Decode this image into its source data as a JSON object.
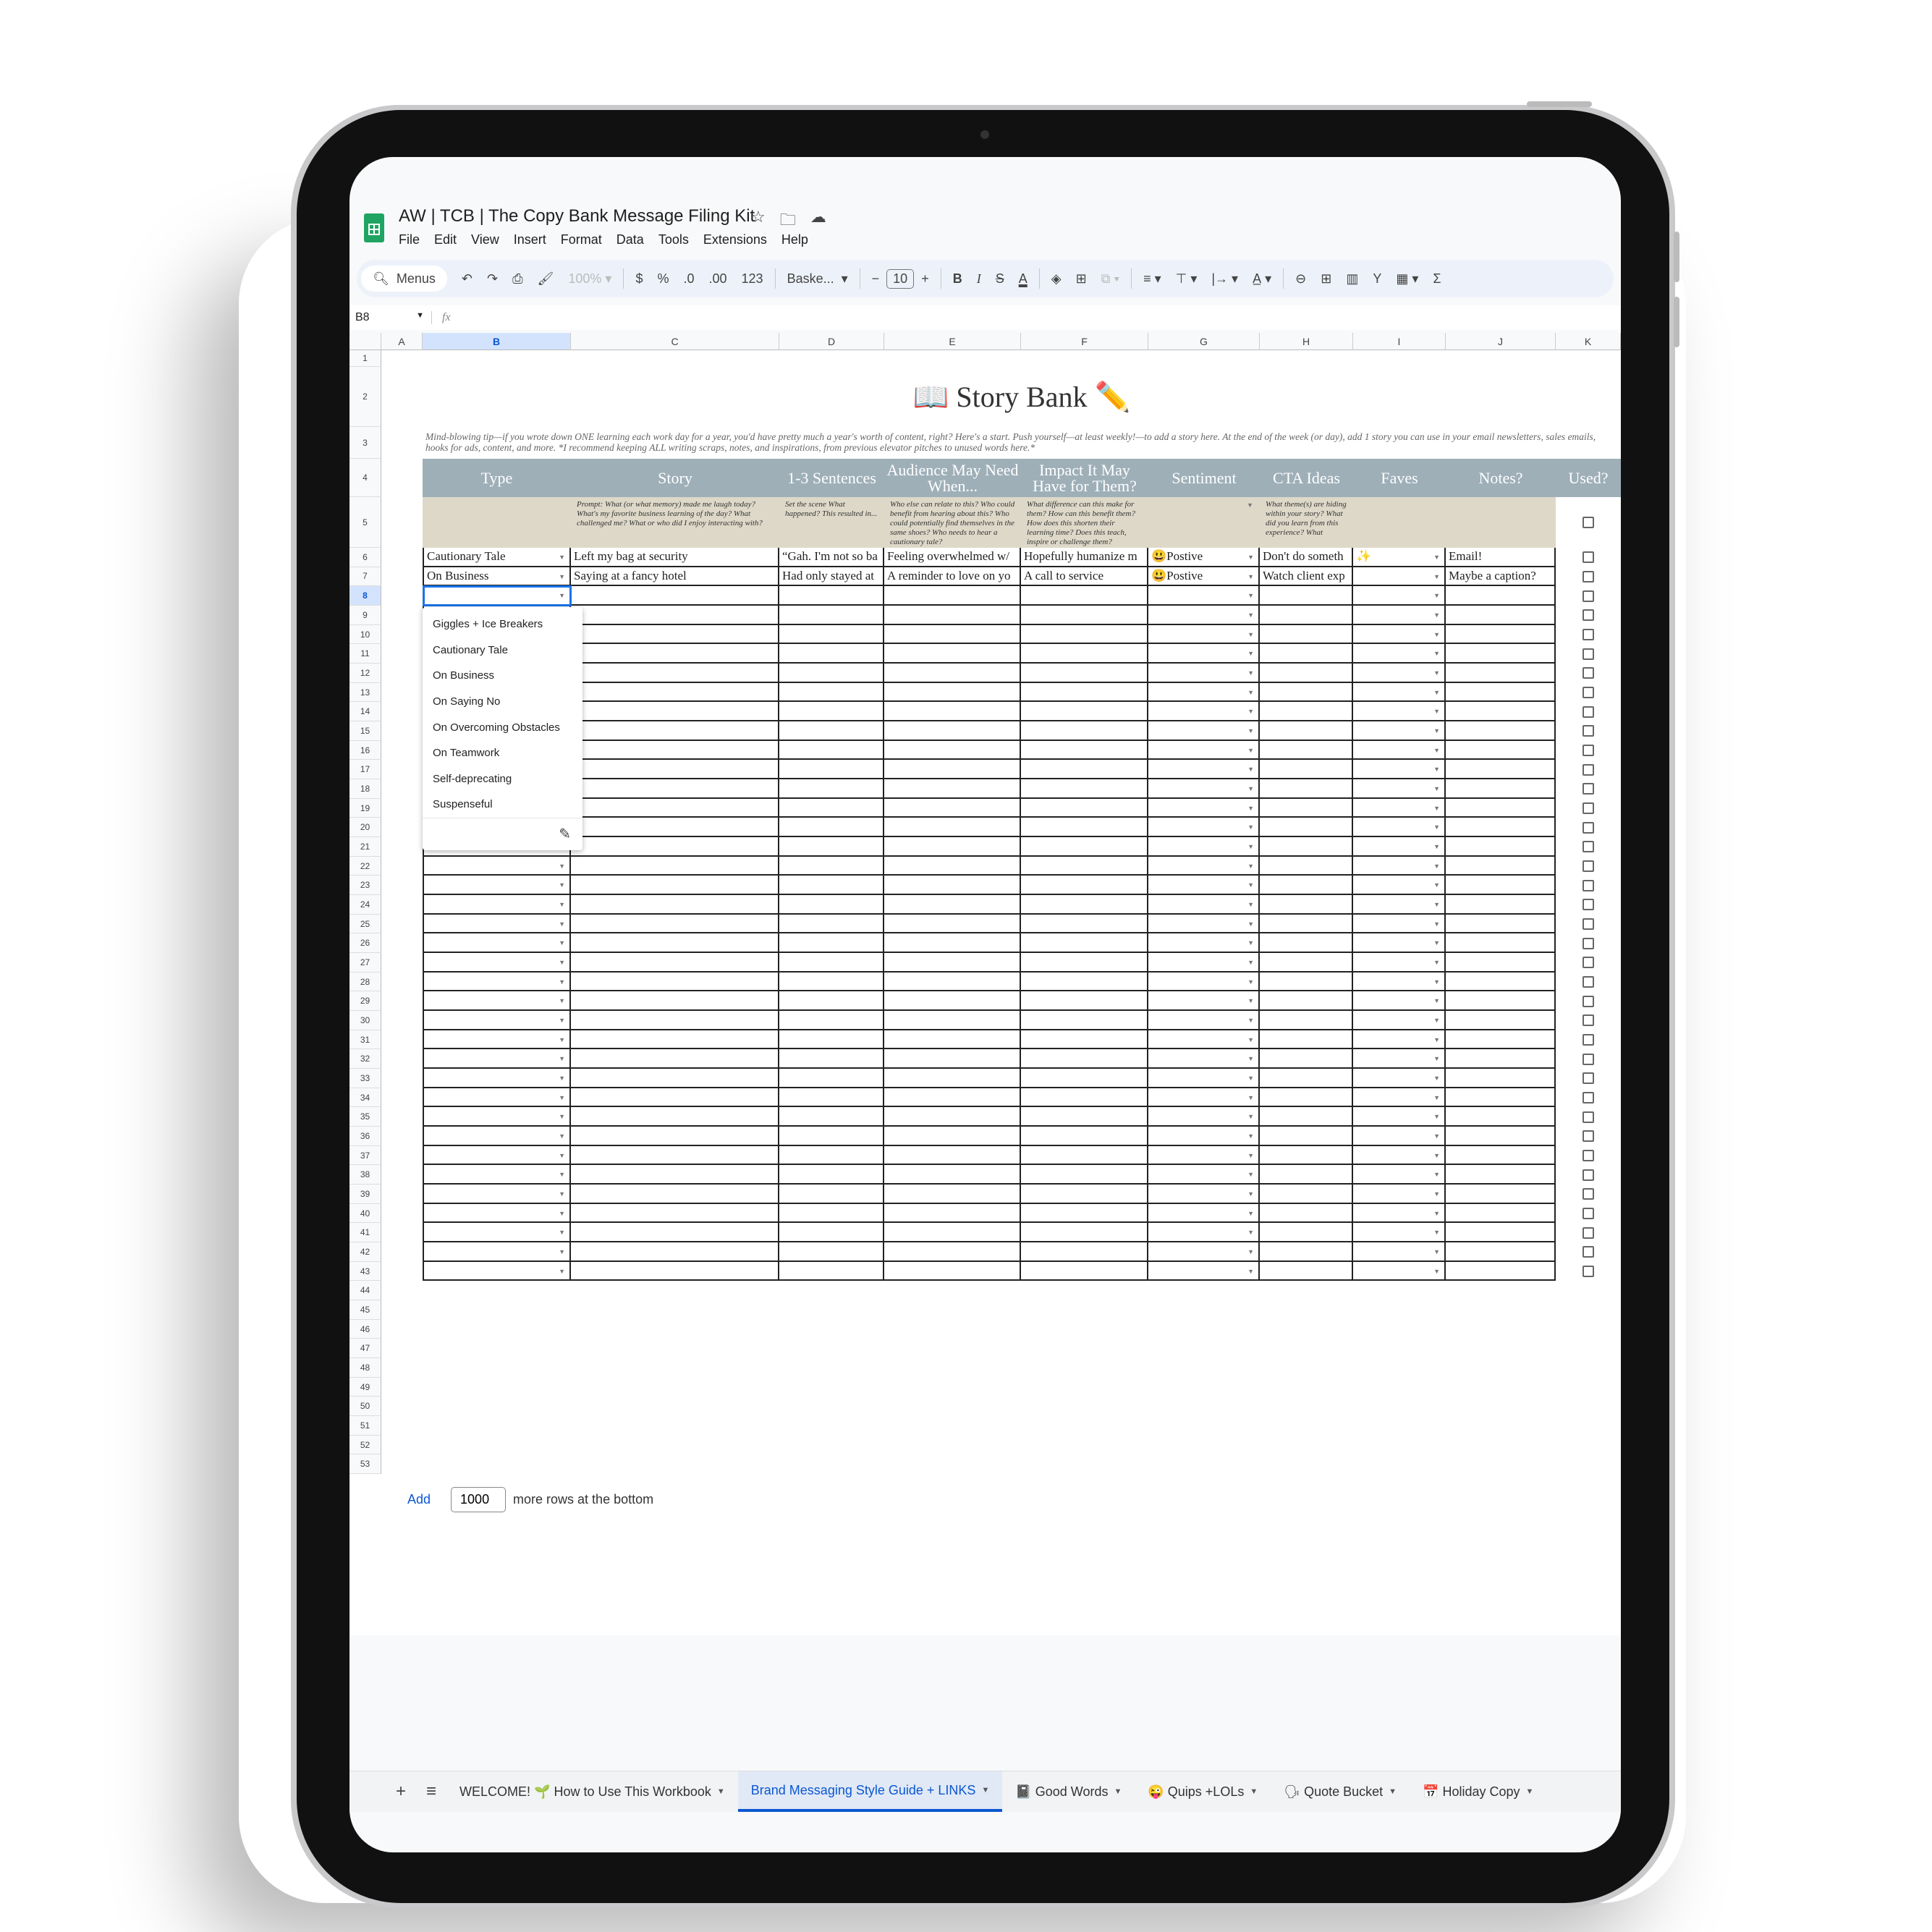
{
  "app": {
    "doc_title": "AW | TCB | The Copy Bank Message Filing Kit",
    "title_icons": [
      "star-icon",
      "move-folder-icon",
      "cloud-status-icon"
    ],
    "menu": [
      "File",
      "Edit",
      "View",
      "Insert",
      "Format",
      "Data",
      "Tools",
      "Extensions",
      "Help"
    ]
  },
  "toolbar": {
    "search_label": "Menus",
    "zoom": "100%",
    "currency": "$",
    "percent": "%",
    "decrease_decimal": ".0",
    "increase_decimal": ".00",
    "number_format": "123",
    "font": "Baske...",
    "font_size": "10",
    "bold": "B",
    "italic": "I"
  },
  "formula_bar": {
    "name_box": "B8",
    "fx": "fx",
    "value": ""
  },
  "columns": [
    "A",
    "B",
    "C",
    "D",
    "E",
    "F",
    "G",
    "H",
    "I",
    "J",
    "K"
  ],
  "selected_column": "B",
  "selected_row": 8,
  "row_count": 53,
  "sheet": {
    "title": "📖 Story Bank ✏️",
    "tip": "Mind-blowing tip—if you wrote down ONE learning each work day for a year, you'd have pretty much a year's worth of content, right? Here's a start. Push yourself—at least weekly!—to add a story here. At the end of the week (or day), add 1 story you can use in your email newsletters, sales emails, hooks for ads, content, and more. *I recommend keeping ALL writing scraps, notes, and inspirations, from previous elevator pitches to unused words here.*",
    "headers": [
      "Type",
      "Story",
      "1-3 Sentences",
      "Audience May Need When...",
      "Impact It May Have for Them?",
      "Sentiment",
      "CTA Ideas",
      "Faves",
      "Notes?",
      "Used?"
    ],
    "prompts": [
      "",
      "Prompt: What (or what memory) made me laugh today? What's my favorite business learning of the day? What challenged me? What or who did I enjoy interacting with?",
      "Set the scene What happened? This resulted in...",
      "Who else can relate to this? Who could benefit from hearing about this? Who could potentially find themselves in the same shoes? Who needs to hear a cautionary tale?",
      "What difference can this make for them? How can this benefit them? How does this shorten their learning time? Does this teach, inspire or challenge them?",
      "",
      "What theme(s) are hiding within your story? What did you learn from this experience? What",
      "",
      ""
    ],
    "rows": [
      [
        "Cautionary Tale",
        "Left my bag at security",
        "“Gah. I'm not so ba",
        "Feeling overwhelmed w/",
        "Hopefully humanize m",
        "😃Postive",
        "Don't do someth",
        "✨",
        "Email!"
      ],
      [
        "On Business",
        "Saying at a fancy hotel",
        "Had only stayed at",
        "A reminder to love on yo",
        "A call to service",
        "😃Postive",
        "Watch client exp",
        "",
        "Maybe a caption?"
      ]
    ],
    "used_checked": [
      false,
      false,
      false
    ]
  },
  "dropdown": {
    "options": [
      "Giggles + Ice Breakers",
      "Cautionary Tale",
      "On Business",
      "On Saying No",
      "On Overcoming Obstacles",
      "On Teamwork",
      "Self-deprecating",
      "Suspenseful"
    ],
    "edit_icon": "pencil-icon"
  },
  "add_rows": {
    "button": "Add",
    "count": "1000",
    "suffix": "more rows at the bottom"
  },
  "tabs": [
    {
      "label": "WELCOME! 🌱 How to Use This Workbook",
      "active": false
    },
    {
      "label": "Brand Messaging Style Guide + LINKS",
      "active": true
    },
    {
      "label": "📓 Good Words",
      "active": false
    },
    {
      "label": "😜 Quips +LOLs",
      "active": false
    },
    {
      "label": "🗣 Quote Bucket",
      "active": false
    },
    {
      "label": "📅 Holiday Copy",
      "active": false
    }
  ],
  "colors": {
    "header_band": "#9eafb8",
    "prompt_band": "#ddd8c8",
    "selection": "#1a73e8",
    "sheets_green": "#1fa463"
  }
}
